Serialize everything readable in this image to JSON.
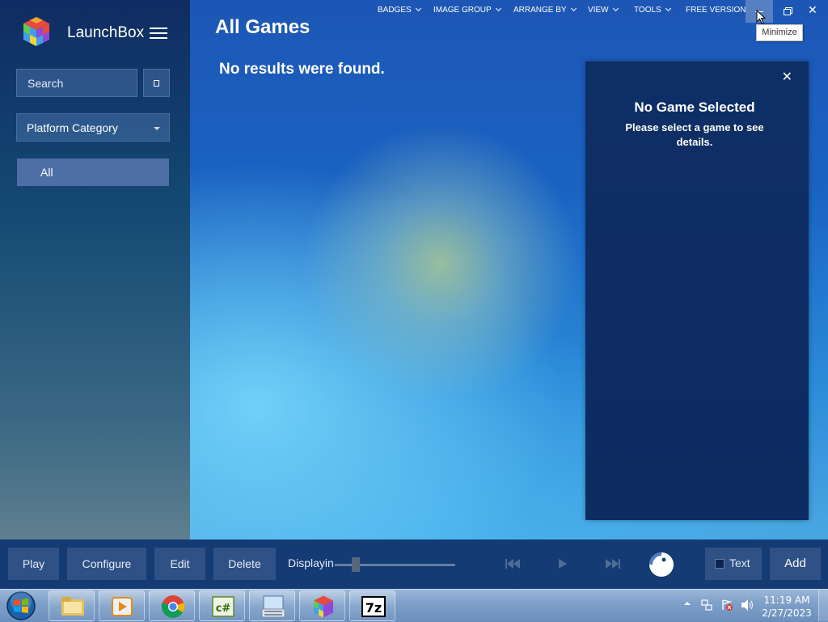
{
  "sidebar": {
    "app_title": "LaunchBox",
    "search_placeholder": "Search",
    "platform_select": "Platform Category",
    "list_items": [
      "All"
    ]
  },
  "main": {
    "page_title": "All Games",
    "no_results": "No results were found."
  },
  "top_menu": {
    "items": [
      "BADGES",
      "IMAGE GROUP",
      "ARRANGE BY",
      "VIEW",
      "TOOLS",
      "FREE VERSION"
    ],
    "tooltip": "Minimize"
  },
  "details": {
    "title": "No Game Selected",
    "message": "Please select a game to see details."
  },
  "toolbar": {
    "play": "Play",
    "configure": "Configure",
    "edit": "Edit",
    "delete": "Delete",
    "displaying": "Displayin",
    "text_toggle": "Text",
    "add": "Add"
  },
  "taskbar": {
    "apps": [
      "windows-explorer",
      "media-player",
      "chrome",
      "csharp-editor",
      "on-screen-keyboard",
      "launchbox",
      "7zip"
    ],
    "app_7z_label": "7z",
    "app_cs_label": "c#",
    "clock_time": "11:19 AM",
    "clock_date": "2/27/2023"
  },
  "colors": {
    "sidebar_bg": "#0f2c63",
    "details_bg": "#0c2c62",
    "toolbar_bg": "#143b74",
    "accent_selected": "#4d6ea6"
  }
}
